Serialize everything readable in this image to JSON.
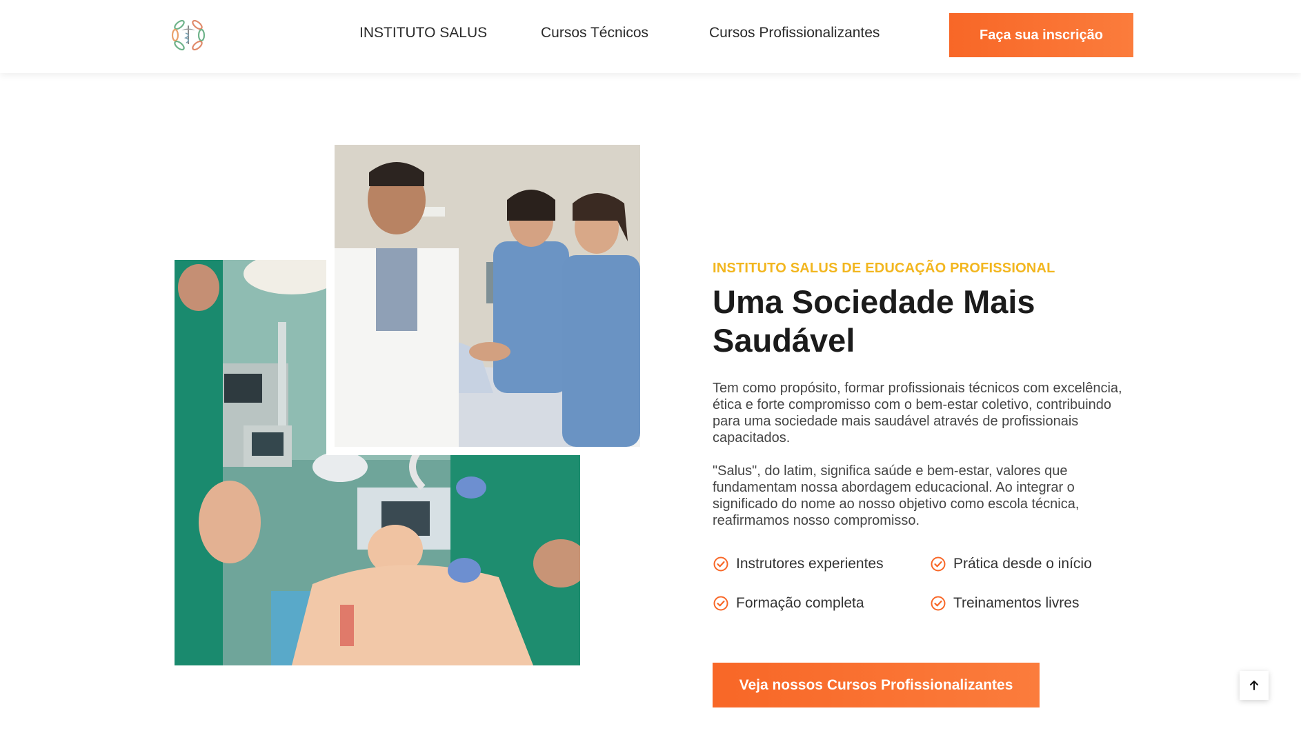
{
  "header": {
    "logo_icon": "caduceus-wreath-logo",
    "nav": [
      {
        "label": "INSTITUTO SALUS"
      },
      {
        "label": "Cursos Técnicos"
      },
      {
        "label": "Cursos Profissionalizantes"
      }
    ],
    "cta_label": "Faça sua inscrição"
  },
  "hero": {
    "eyebrow": "INSTITUTO SALUS DE EDUCAÇÃO PROFISSIONAL",
    "title": "Uma Sociedade Mais Saudável",
    "paragraphs": [
      "Tem como propósito, formar profissionais técnicos com excelência, ética e forte compromisso com o bem-estar coletivo, contribuindo para uma sociedade mais saudável através de profissionais capacitados.",
      "\"Salus\", do latim, significa saúde e bem-estar, valores que fundamentam nossa abordagem educacional. Ao integrar o significado do nome ao nosso objetivo como escola técnica, reafirmamos nosso compromisso."
    ],
    "features": [
      {
        "label": "Instrutores experientes",
        "icon": "check-circle-icon"
      },
      {
        "label": "Prática desde o início",
        "icon": "check-circle-icon"
      },
      {
        "label": "Formação completa",
        "icon": "check-circle-icon"
      },
      {
        "label": "Treinamentos livres",
        "icon": "check-circle-icon"
      }
    ],
    "cta_label": "Veja nossos Cursos Profissionalizantes"
  },
  "images": {
    "front": "doctor-and-nurses-with-patient-photo",
    "back": "medical-students-training-with-mannequin-photo"
  },
  "colors": {
    "accent": "#f86727",
    "eyebrow": "#f2b61f",
    "heading": "#1b1b1b",
    "body": "#454545"
  },
  "back_to_top_icon": "arrow-up-icon"
}
